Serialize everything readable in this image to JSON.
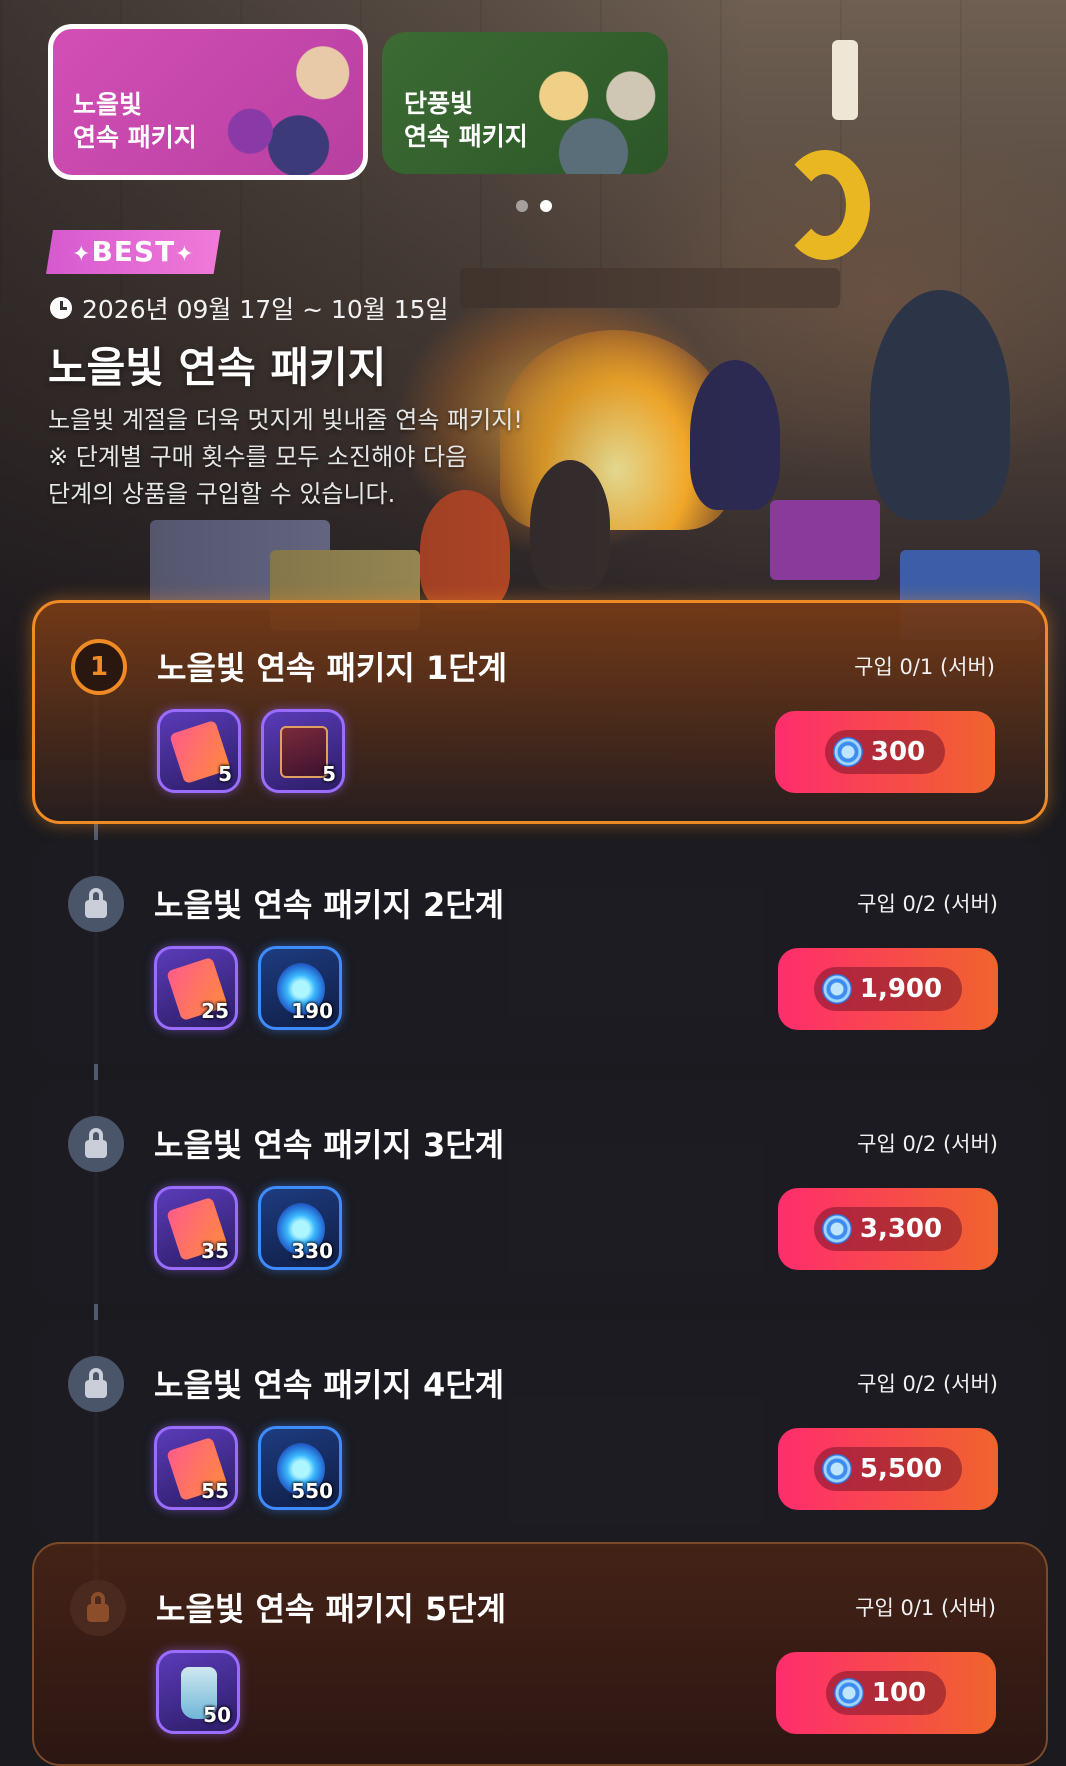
{
  "banners": [
    {
      "label": "노을빛\n연속 패키지",
      "selected": true
    },
    {
      "label": "단풍빛\n연속 패키지",
      "selected": false
    }
  ],
  "pagination": {
    "active": 1,
    "total": 2
  },
  "badge": "BEST",
  "period": "2026년 09월 17일 ~ 10월 15일",
  "title": "노을빛 연속 패키지",
  "description": [
    "노을빛 계절을 더욱 멋지게 빛내줄 연속 패키지!",
    "※ 단계별 구매 횟수를 모두 소진해야 다음",
    "단계의 상품을 구입할 수 있습니다."
  ],
  "packages": [
    {
      "title": "노을빛 연속 패키지 1단계",
      "limit": "구입 0/1 (서버)",
      "step": "1",
      "state": "active",
      "items": [
        {
          "icon": "ticket-icon",
          "qty": "5"
        },
        {
          "icon": "card-icon",
          "qty": "5"
        }
      ],
      "price": "300"
    },
    {
      "title": "노을빛 연속 패키지 2단계",
      "limit": "구입 0/2 (서버)",
      "step": "",
      "state": "locked",
      "items": [
        {
          "icon": "ticket-icon",
          "qty": "25"
        },
        {
          "icon": "gem-icon",
          "qty": "190"
        }
      ],
      "price": "1,900"
    },
    {
      "title": "노을빛 연속 패키지 3단계",
      "limit": "구입 0/2 (서버)",
      "step": "",
      "state": "locked",
      "items": [
        {
          "icon": "ticket-icon",
          "qty": "35"
        },
        {
          "icon": "gem-icon",
          "qty": "330"
        }
      ],
      "price": "3,300"
    },
    {
      "title": "노을빛 연속 패키지 4단계",
      "limit": "구입 0/2 (서버)",
      "step": "",
      "state": "locked",
      "items": [
        {
          "icon": "ticket-icon",
          "qty": "55"
        },
        {
          "icon": "gem-icon",
          "qty": "550"
        }
      ],
      "price": "5,500"
    },
    {
      "title": "노을빛 연속 패키지 5단계",
      "limit": "구입 0/1 (서버)",
      "step": "",
      "state": "locked",
      "items": [
        {
          "icon": "potion-icon",
          "qty": "50"
        }
      ],
      "price": "100"
    }
  ],
  "colors": {
    "accent_orange": "#f08a24",
    "price_start": "#ff2d6d",
    "price_end": "#f0642c",
    "badge_pink": "#e06ad4"
  }
}
